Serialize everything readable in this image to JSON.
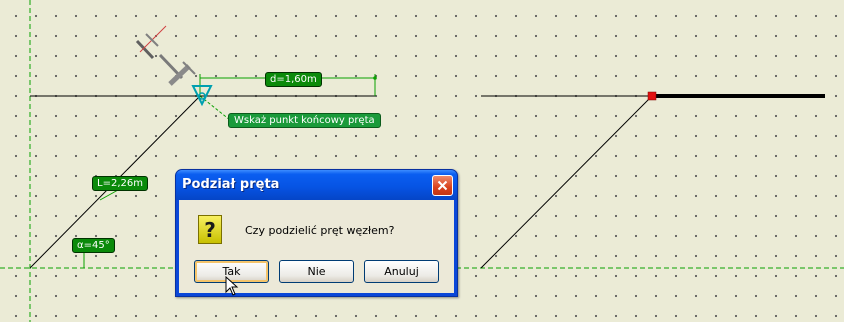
{
  "canvas": {
    "tags": {
      "distance": "d=1,60m",
      "hint": "Wskaż punkt końcowy pręta",
      "length": "L=2,26m",
      "angle": "α=45°"
    }
  },
  "dialog": {
    "title": "Podział pręta",
    "message": "Czy podzielić pręt węzłem?",
    "buttons": {
      "yes": "Tak",
      "no": "Nie",
      "cancel": "Anuluj"
    }
  },
  "icons": {
    "question": "question-icon",
    "close": "close-icon",
    "cursor": "mouse-pointer-icon"
  },
  "colors": {
    "background": "#ebebd6",
    "guide": "#0aa000",
    "tag": "#0a8a0a",
    "node": "#e01010",
    "dialog_title": "#0654e4"
  }
}
